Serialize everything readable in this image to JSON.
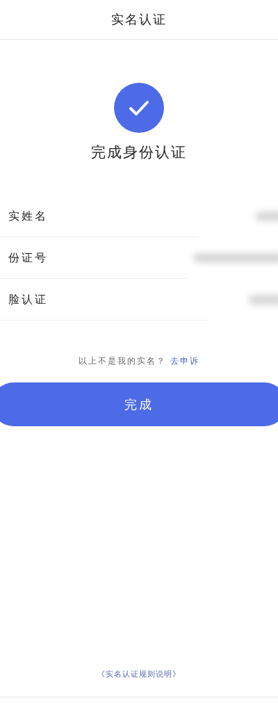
{
  "header": {
    "title": "实名认证"
  },
  "status": {
    "title": "完成身份认证"
  },
  "fields": [
    {
      "label": "实姓名"
    },
    {
      "label": "份证号"
    },
    {
      "label": "脸认证"
    }
  ],
  "appeal": {
    "text": "以上不是我的实名？",
    "link": "去申诉"
  },
  "done_button": "完成",
  "rules_link": "《实名认证规则说明》"
}
